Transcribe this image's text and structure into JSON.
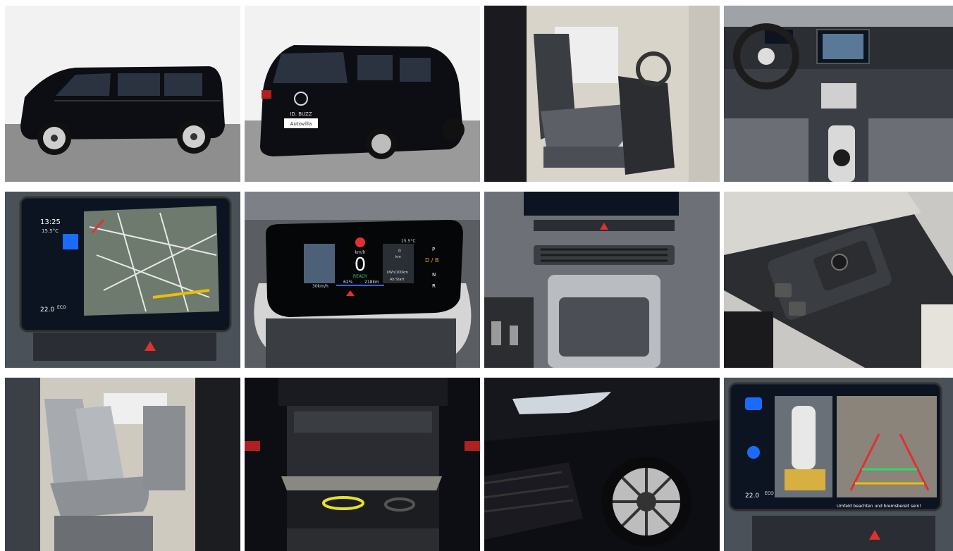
{
  "gallery": {
    "photos": [
      {
        "id": "exterior-side",
        "alt": "Exterior side view"
      },
      {
        "id": "exterior-rear",
        "alt": "Exterior rear three-quarter view"
      },
      {
        "id": "front-seat-door",
        "alt": "Front passenger seat through open door"
      },
      {
        "id": "cockpit",
        "alt": "Steering wheel and dashboard"
      },
      {
        "id": "infotainment-nav",
        "alt": "Infotainment navigation screen"
      },
      {
        "id": "driver-display",
        "alt": "Driver display"
      },
      {
        "id": "center-console",
        "alt": "Center console and air vents"
      },
      {
        "id": "door-controls",
        "alt": "Door window and mirror controls"
      },
      {
        "id": "rear-seats",
        "alt": "Rear seats through sliding door"
      },
      {
        "id": "cargo",
        "alt": "Cargo area with charging cables"
      },
      {
        "id": "headlight-wheel",
        "alt": "Headlight and front wheel"
      },
      {
        "id": "parking-camera",
        "alt": "Parking camera screen"
      }
    ]
  },
  "nav_screen": {
    "time": "13:25",
    "temp": "15.5°C",
    "climate_temp": "22.0",
    "eco_label": "ECO"
  },
  "driver_display": {
    "speed": "0",
    "speed_unit": "km/h",
    "ready": "READY",
    "limit": "30km/h",
    "battery": "62%",
    "range": "218km",
    "gears": [
      "P",
      "D / B",
      "N",
      "R"
    ],
    "outside_temp": "15.5°C",
    "consumption_value": "0",
    "consumption_unit": "km",
    "efficiency_unit": "kWh/100km",
    "right_label": "Ab Start"
  },
  "rear_badge": {
    "model": "ID. BUZZ",
    "plate": "Autovilla"
  },
  "park_screen": {
    "climate_temp": "22.0",
    "eco_label": "ECO",
    "warning": "Umfeld beachten und bremsbereit sein!"
  },
  "colors": {
    "car_black": "#0d0d14",
    "screen_bg": "#0b1420",
    "accent_blue": "#1a6cff",
    "ready_green": "#2fd86a",
    "warning_red": "#e03030",
    "interior_grey": "#9ea3a8"
  }
}
